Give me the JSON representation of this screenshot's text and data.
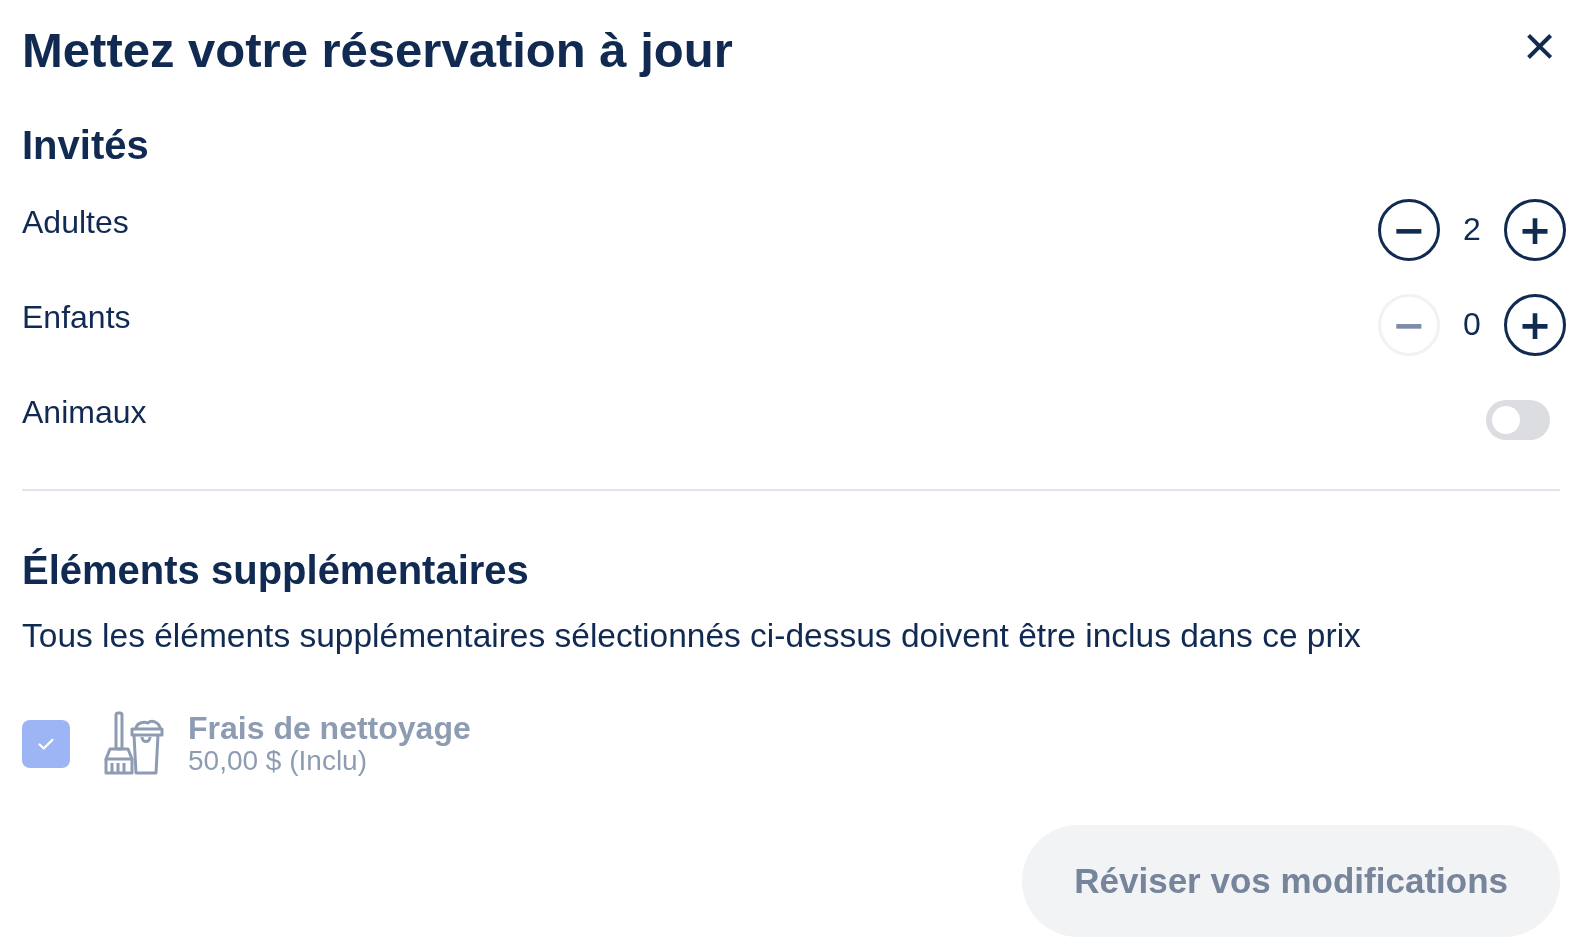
{
  "title": "Mettez votre réservation à jour",
  "close": "×",
  "guests": {
    "heading": "Invités",
    "rows": [
      {
        "kind": "counter",
        "label": "Adultes",
        "value": "2",
        "minus": "−",
        "plus": "+",
        "minus_disabled": false
      },
      {
        "kind": "counter",
        "label": "Enfants",
        "value": "0",
        "minus": "−",
        "plus": "+",
        "minus_disabled": true
      },
      {
        "kind": "toggle",
        "label": "Animaux",
        "on": false
      }
    ]
  },
  "extras": {
    "heading": "Éléments supplémentaires",
    "description": "Tous les éléments supplémentaires sélectionnés ci-dessus doivent être inclus dans ce prix",
    "items": [
      {
        "name": "Frais de nettoyage",
        "price": "50,00 $ (Inclu)",
        "checked": true,
        "disabled": true
      }
    ]
  },
  "submit": {
    "label": "Réviser vos modifications",
    "disabled": true
  }
}
